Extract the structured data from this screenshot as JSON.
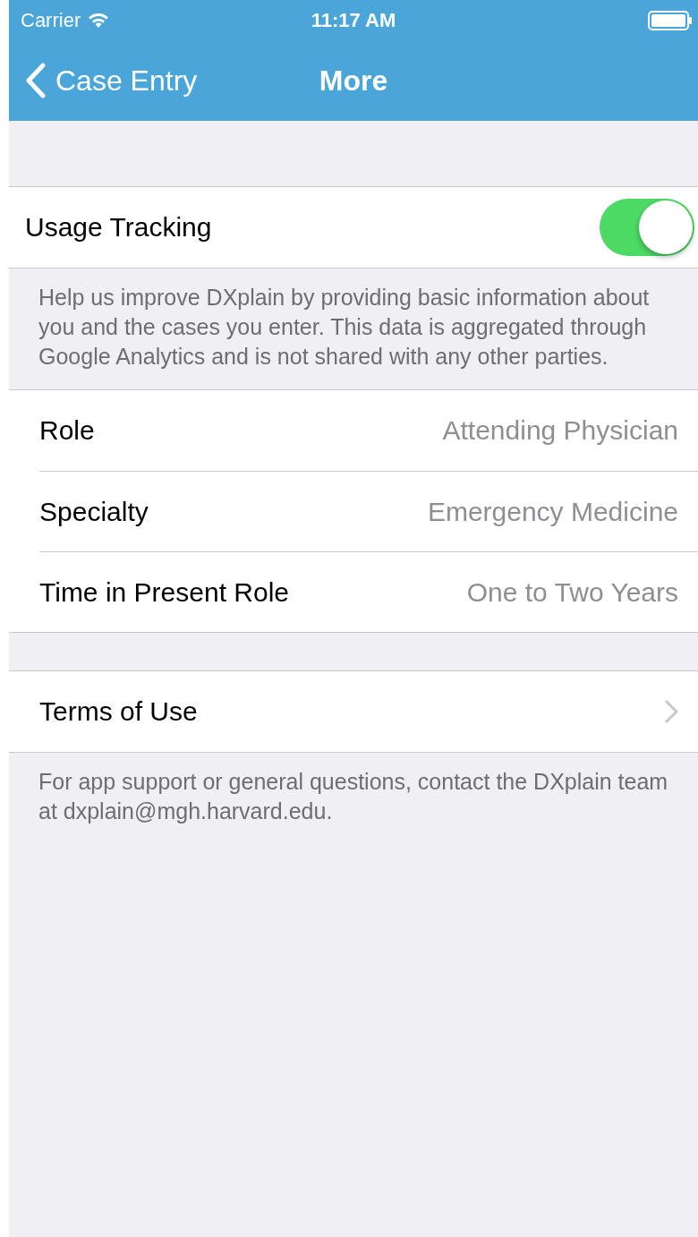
{
  "status_bar": {
    "carrier": "Carrier",
    "time": "11:17 AM"
  },
  "nav": {
    "back_label": "Case Entry",
    "title": "More"
  },
  "sections": [
    {
      "rows": [
        {
          "kind": "toggle",
          "label": "Usage Tracking",
          "on": true
        }
      ],
      "footer": "Help us improve DXplain by providing basic information about you and the cases you enter. This data is aggregated through Google Analytics and is not shared with any other parties."
    },
    {
      "rows": [
        {
          "kind": "value",
          "label": "Role",
          "value": "Attending Physician"
        },
        {
          "kind": "value",
          "label": "Specialty",
          "value": "Emergency Medicine"
        },
        {
          "kind": "value",
          "label": "Time in Present Role",
          "value": "One to Two Years"
        }
      ]
    },
    {
      "rows": [
        {
          "kind": "disclosure",
          "label": "Terms of Use"
        }
      ],
      "footer": "For app support or general questions, contact the DXplain team at dxplain@mgh.harvard.edu."
    }
  ]
}
